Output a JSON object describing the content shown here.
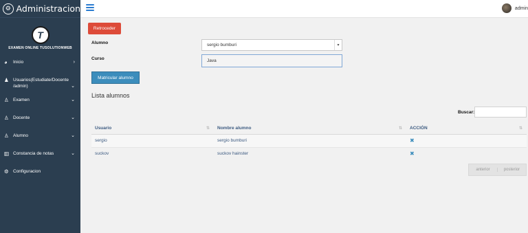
{
  "sidebar": {
    "brand_title": "Administracion",
    "brand_icon": "gear-icon",
    "logo_letter": "T",
    "logo_text": "EXAMEN ONLINE TUSOLUTIONWEB",
    "items": [
      {
        "label": "Inicio",
        "icon": "dashboard-icon",
        "chevron": "›"
      },
      {
        "label": "Usuarios(Estudiate/Docente /admin)",
        "icon": "users-icon",
        "chevron": "⌄"
      },
      {
        "label": "Examen",
        "icon": "user-tie-icon",
        "chevron": "⌄"
      },
      {
        "label": "Docente",
        "icon": "user-tie-icon",
        "chevron": "⌄"
      },
      {
        "label": "Alumno",
        "icon": "user-tie-icon",
        "chevron": "⌄"
      },
      {
        "label": "Constancia de notas",
        "icon": "bar-chart-icon",
        "chevron": "⌄"
      },
      {
        "label": "Configuracion",
        "icon": "gear-icon",
        "chevron": ""
      }
    ]
  },
  "topbar": {
    "menu_icon": "hamburger-icon",
    "user_name": "admin"
  },
  "form": {
    "back_label": "Retroceder",
    "alumno_label": "Alumno",
    "alumno_value": "sergio bumburi",
    "curso_label": "Curso",
    "curso_value": "Java",
    "enroll_label": "Matricular alumno"
  },
  "list": {
    "title": "Lista alumnos",
    "search_label": "Buscar:",
    "columns": [
      "Usuario",
      "Nombre alumno",
      "ACCIÓN"
    ],
    "rows": [
      {
        "usuario": "sergio",
        "nombre": "sergio bumburi",
        "accion": "✖"
      },
      {
        "usuario": "suckov",
        "nombre": "suckov hainster",
        "accion": "✖"
      }
    ],
    "pager_prev": "anterior",
    "pager_next": "posterior"
  },
  "colors": {
    "sidebar": "#2b3e50",
    "danger": "#dd4b39",
    "primary": "#3c8dbc"
  }
}
